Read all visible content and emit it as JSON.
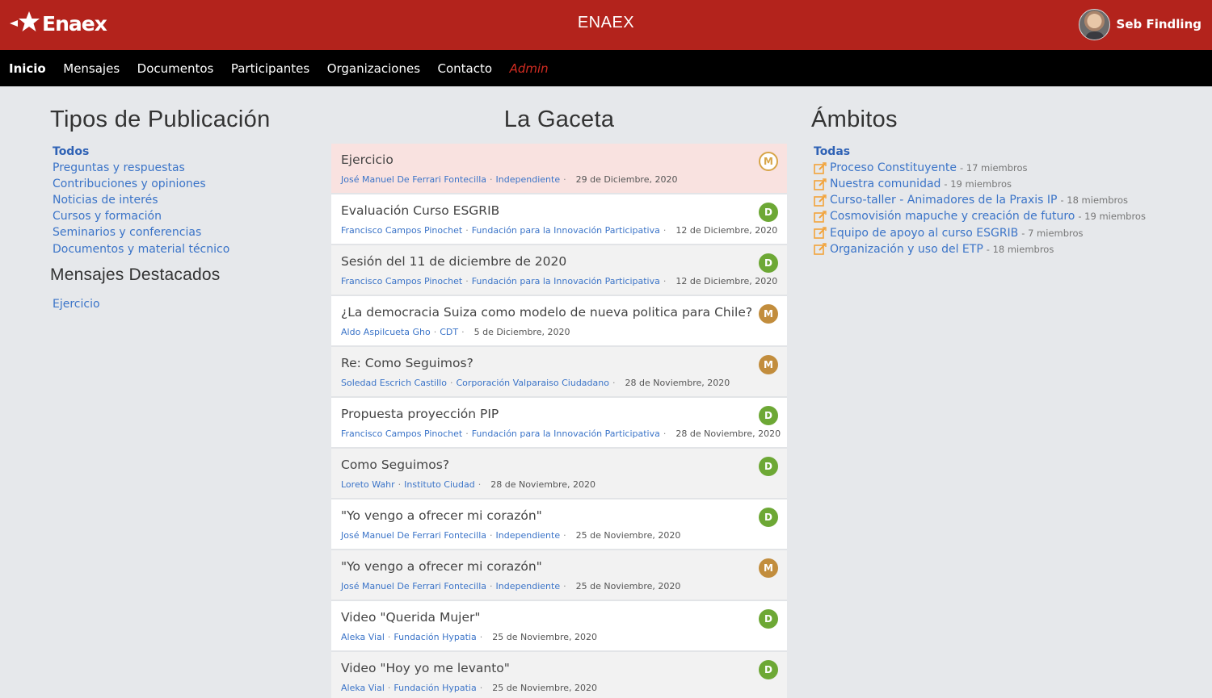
{
  "header": {
    "logo_text": "Enaex",
    "title": "ENAEX",
    "user_name": "Seb Findling",
    "brand_color": "#b3231c"
  },
  "nav": {
    "items": [
      {
        "label": "Inicio"
      },
      {
        "label": "Mensajes"
      },
      {
        "label": "Documentos"
      },
      {
        "label": "Participantes"
      },
      {
        "label": "Organizaciones"
      },
      {
        "label": "Contacto"
      },
      {
        "label": "Admin"
      }
    ]
  },
  "left": {
    "title": "Tipos de Publicación",
    "types": [
      "Todos",
      "Preguntas y respuestas",
      "Contribuciones y opiniones",
      "Noticias de interés",
      "Cursos y formación",
      "Seminarios y conferencias",
      "Documentos y material técnico"
    ],
    "featured_title": "Mensajes Destacados",
    "featured": [
      "Ejercicio"
    ]
  },
  "center": {
    "title": "La Gaceta",
    "posts": [
      {
        "title": "Ejercicio",
        "author": "José Manuel De Ferrari Fontecilla",
        "org": "Independiente",
        "date": "29 de Diciembre, 2020",
        "badge": "M"
      },
      {
        "title": "Evaluación Curso ESGRIB",
        "author": "Francisco Campos Pinochet",
        "org": "Fundación para la Innovación Participativa",
        "date": "12 de Diciembre, 2020",
        "badge": "D"
      },
      {
        "title": "Sesión del 11 de diciembre de 2020",
        "author": "Francisco Campos Pinochet",
        "org": "Fundación para la Innovación Participativa",
        "date": "12 de Diciembre, 2020",
        "badge": "D"
      },
      {
        "title": "¿La democracia Suiza como modelo de nueva politica para Chile?",
        "author": "Aldo Aspilcueta Gho",
        "org": "CDT",
        "date": "5 de Diciembre, 2020",
        "badge": "M"
      },
      {
        "title": "Re: Como Seguimos?",
        "author": "Soledad Escrich Castillo",
        "org": "Corporación Valparaiso Ciudadano",
        "date": "28 de Noviembre, 2020",
        "badge": "M"
      },
      {
        "title": "Propuesta proyección PIP",
        "author": "Francisco Campos Pinochet",
        "org": "Fundación para la Innovación Participativa",
        "date": "28 de Noviembre, 2020",
        "badge": "D"
      },
      {
        "title": "Como Seguimos?",
        "author": "Loreto Wahr",
        "org": "Instituto Ciudad",
        "date": "28 de Noviembre, 2020",
        "badge": "D"
      },
      {
        "title": "\"Yo vengo a ofrecer mi corazón\"",
        "author": "José Manuel De Ferrari Fontecilla",
        "org": "Independiente",
        "date": "25 de Noviembre, 2020",
        "badge": "D"
      },
      {
        "title": "\"Yo vengo a ofrecer mi corazón\"",
        "author": "José Manuel De Ferrari Fontecilla",
        "org": "Independiente",
        "date": "25 de Noviembre, 2020",
        "badge": "M"
      },
      {
        "title": "Video \"Querida Mujer\"",
        "author": "Aleka Vial",
        "org": "Fundación Hypatia",
        "date": "25 de Noviembre, 2020",
        "badge": "D"
      },
      {
        "title": "Video \"Hoy yo me levanto\"",
        "author": "Aleka Vial",
        "org": "Fundación Hypatia",
        "date": "25 de Noviembre, 2020",
        "badge": "D"
      }
    ]
  },
  "right": {
    "title": "Ámbitos",
    "all_label": "Todas",
    "items": [
      {
        "name": "Proceso Constituyente",
        "count": "- 17 miembros"
      },
      {
        "name": "Nuestra comunidad",
        "count": "- 19 miembros"
      },
      {
        "name": "Curso-taller - Animadores de la Praxis IP",
        "count": "- 18 miembros"
      },
      {
        "name": "Cosmovisión mapuche y creación de futuro",
        "count": "- 19 miembros"
      },
      {
        "name": "Equipo de apoyo al curso ESGRIB",
        "count": "- 7 miembros"
      },
      {
        "name": "Organización y uso del ETP",
        "count": "- 18 miembros"
      }
    ]
  }
}
